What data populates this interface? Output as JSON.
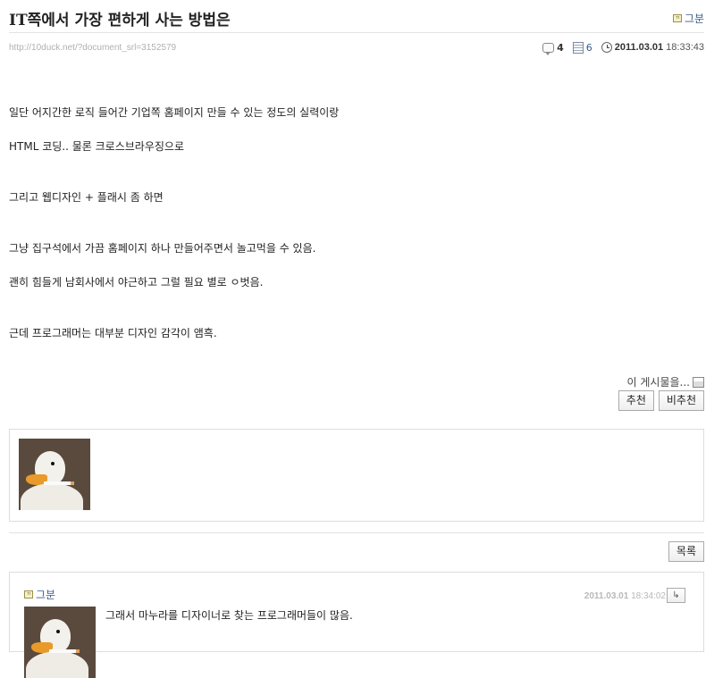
{
  "post": {
    "title": "IT쪽에서 가장 편하게 사는 방법은",
    "author": "그분",
    "url": "http://10duck.net/?document_srl=3152579",
    "comment_count": "4",
    "view_count": "6",
    "date": "2011.03.01",
    "time": "18:33:43"
  },
  "content": {
    "lines": [
      "일단 어지간한 로직 들어간 기업쪽 홈페이지 만들 수 있는 정도의 실력이랑",
      "HTML 코딩.. 물론 크로스브라우징으로",
      "그리고 웹디자인 + 플래시 좀 하면",
      "그냥 집구석에서 가끔 홈페이지 하나 만들어주면서 놀고먹을 수 있음.",
      "괜히 힘들게 남회사에서 야근하고 그럴 필요 별로 ㅇ벗음.",
      "근데 프로그래머는 대부분 디자인 감각이 앰흑."
    ]
  },
  "vote": {
    "label": "이 게시물을...",
    "recommend": "추천",
    "not_recommend": "비추천"
  },
  "list_button": "목록",
  "comment": {
    "author": "그분",
    "date": "2011.03.01",
    "time": "18:34:02",
    "text": "그래서 마누라를 디자이너로 찾는 프로그래머들이 많음."
  },
  "icons": {
    "author": "author-badge-icon",
    "comments": "comment-icon",
    "views": "views-icon",
    "time": "clock-icon",
    "print": "print-icon",
    "reply": "reply-icon"
  }
}
